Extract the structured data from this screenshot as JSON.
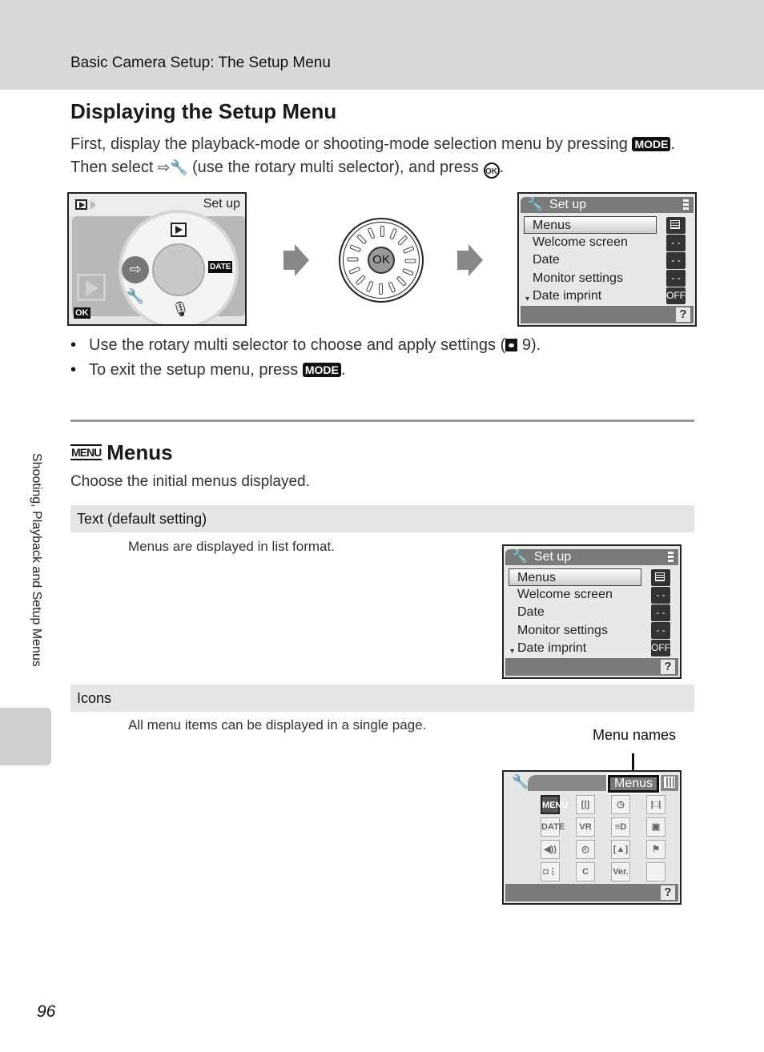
{
  "header": {
    "section_title": "Basic Camera Setup: The Setup Menu"
  },
  "section1": {
    "title": "Displaying the Setup Menu",
    "intro_part1": "First, display the playback-mode or shooting-mode selection menu by pressing",
    "mode_key": "MODE",
    "intro_part2": ". Then select",
    "intro_part3": "(use the rotary multi selector), and press",
    "ok_key": "OK",
    "intro_end": "."
  },
  "screen_mode_select": {
    "label": "Set up",
    "icons": [
      "playback-icon",
      "setup-wrench-icon",
      "date-icon",
      "voice-memo-icon"
    ],
    "date_icon_text": "DATE",
    "ok_badge": "OK"
  },
  "dial": {
    "center_label": "OK"
  },
  "setup_list_screen": {
    "title": "Set up",
    "items": [
      {
        "label": "Menus",
        "value": "menu-list-icon",
        "selected": true
      },
      {
        "label": "Welcome screen",
        "value": "- -"
      },
      {
        "label": "Date",
        "value": "- -"
      },
      {
        "label": "Monitor settings",
        "value": "- -"
      },
      {
        "label": "Date imprint",
        "value": "OFF"
      }
    ],
    "help": "?"
  },
  "bullets": {
    "b1_text": "Use the rotary multi selector to choose and apply settings (",
    "b1_ref": "9).",
    "b2_text": "To exit the setup menu, press",
    "b2_key": "MODE",
    "b2_end": "."
  },
  "section2": {
    "icon_text": "MENU",
    "title": "Menus",
    "lead": "Choose the initial menus displayed.",
    "options": [
      {
        "name": "Text (default setting)",
        "description": "Menus are displayed in list format."
      },
      {
        "name": "Icons",
        "description": "All menu items can be displayed in a single page."
      }
    ]
  },
  "icon_screen": {
    "callout": "Menu names",
    "menu_name": "Menus",
    "help": "?",
    "grid": [
      [
        "MENU",
        "[|]",
        "◷",
        "|□|"
      ],
      [
        "DATE",
        "VR",
        "≡D",
        "▣"
      ],
      [
        "◀))",
        "◴",
        "[▲]",
        "⚑"
      ],
      [
        "◘⋮",
        "C",
        "Ver.",
        ""
      ]
    ]
  },
  "side_tab": {
    "label": "Shooting, Playback and Setup Menus"
  },
  "page_number": "96"
}
